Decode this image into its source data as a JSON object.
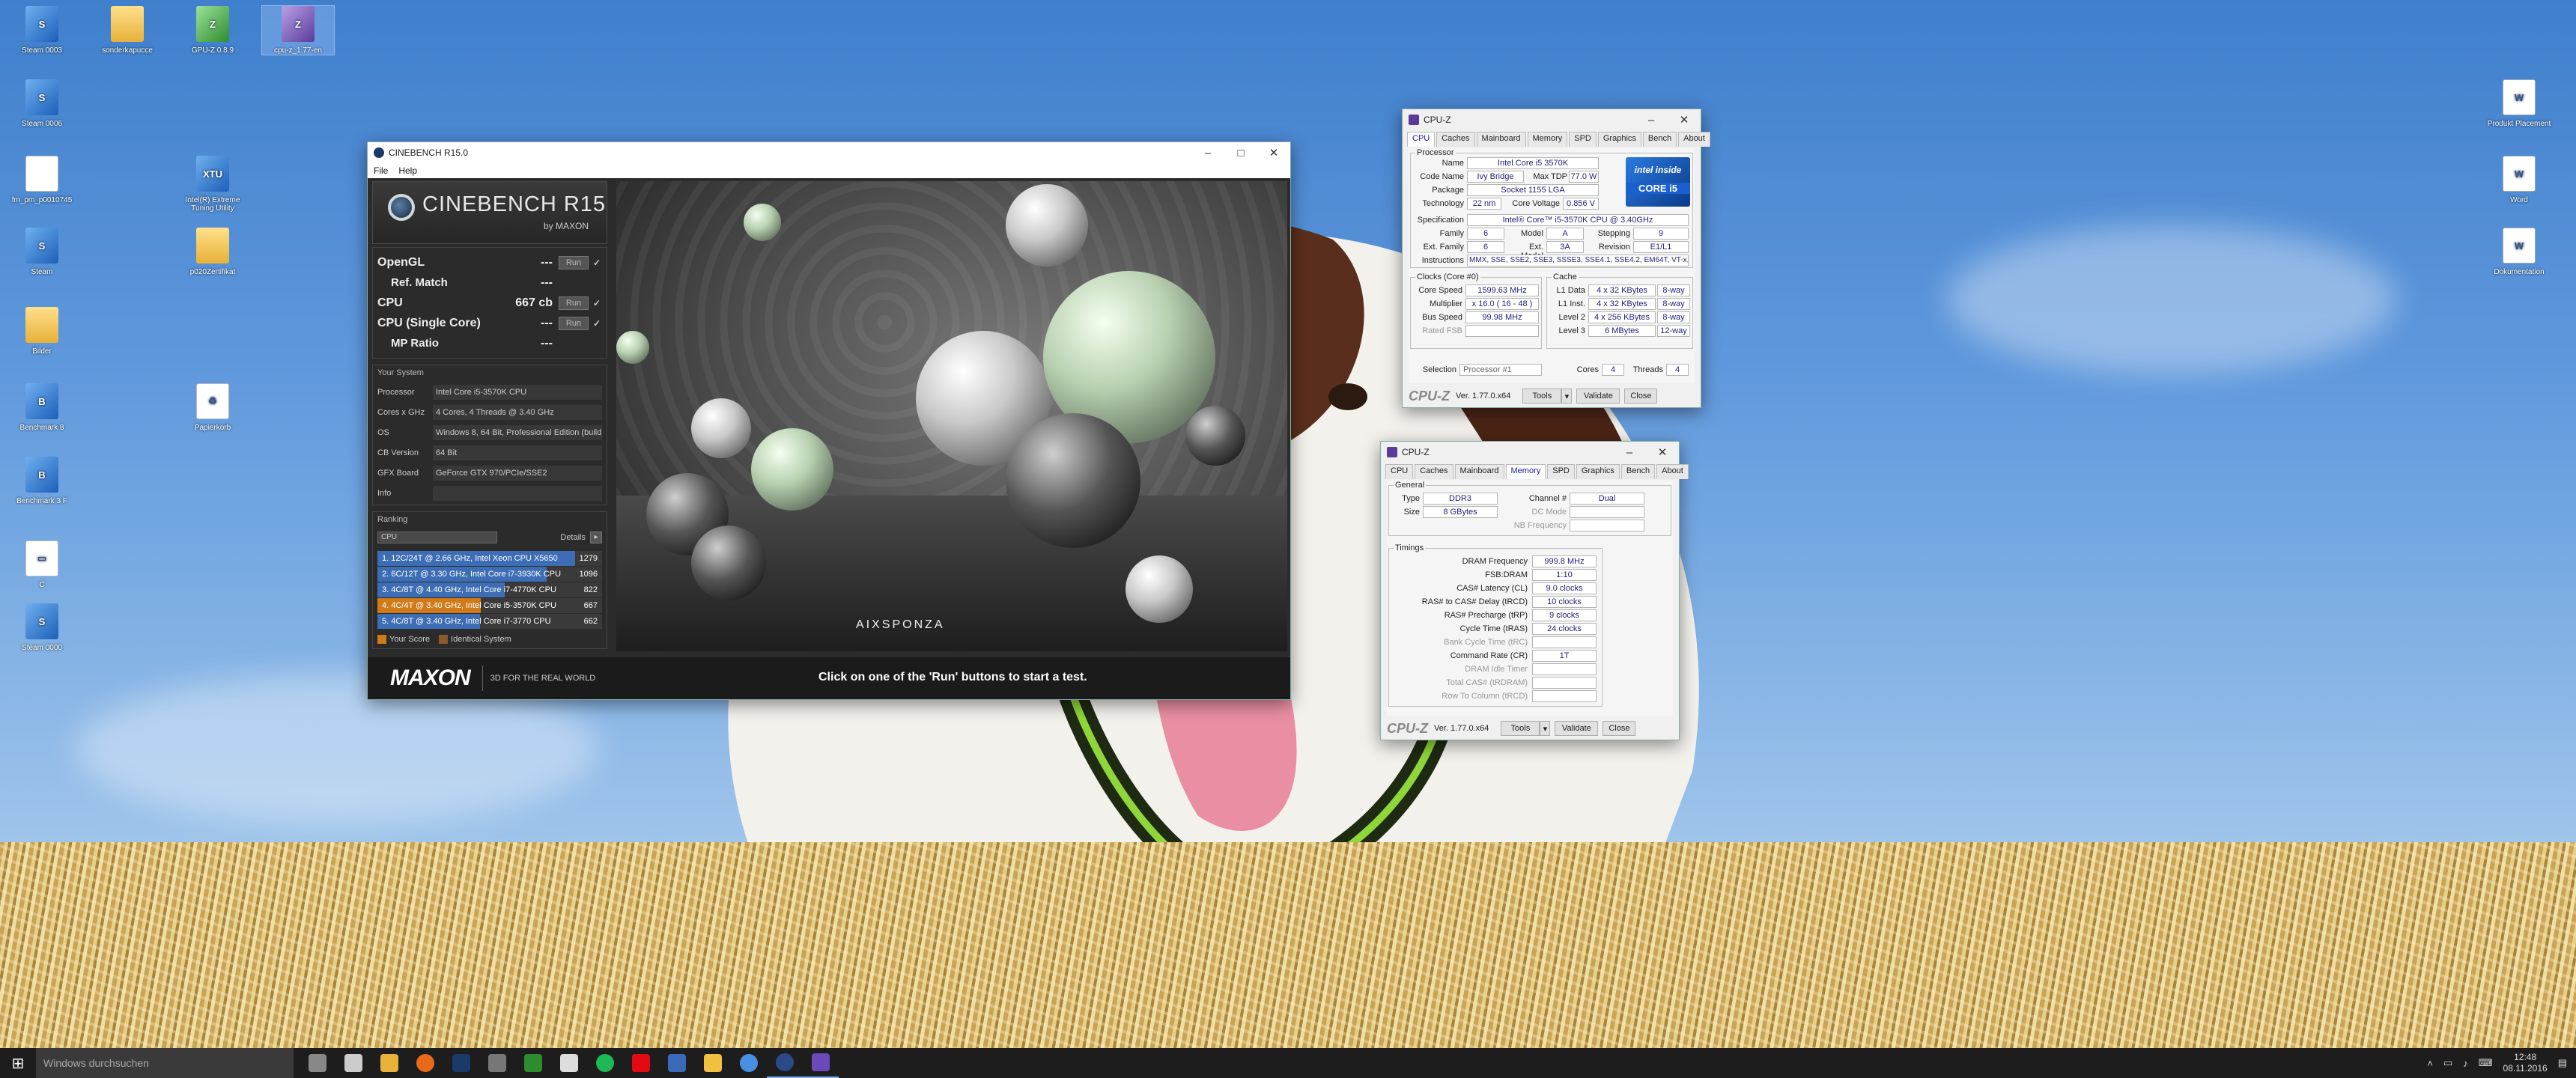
{
  "desktop_icons": [
    {
      "label": "Steam 0003",
      "glyph": "S"
    },
    {
      "label": "sonderkapucce",
      "glyph": ""
    },
    {
      "label": "GPU-Z 0.8.9",
      "glyph": "Z"
    },
    {
      "label": "cpu-z_1.77-en",
      "glyph": "Z"
    },
    {
      "label": "Steam 0006",
      "glyph": "S"
    },
    {
      "label": "fm_pm_p0010745",
      "glyph": ""
    },
    {
      "label": "Intel(R) Extreme Tuning Utility",
      "glyph": "XTU"
    },
    {
      "label": "Steam",
      "glyph": "S"
    },
    {
      "label": "p020Zertifikat",
      "glyph": ""
    },
    {
      "label": "Bilder",
      "glyph": ""
    },
    {
      "label": "Benchmark 8",
      "glyph": "B"
    },
    {
      "label": "Papierkorb",
      "glyph": "♻"
    },
    {
      "label": "Benchmark 3 F",
      "glyph": "B"
    },
    {
      "label": "C",
      "glyph": "▭"
    },
    {
      "label": "Steam 0000",
      "glyph": "S"
    },
    {
      "label": "Produkt Placement",
      "glyph": "W"
    },
    {
      "label": "Word",
      "glyph": "W"
    },
    {
      "label": "Dokumentation",
      "glyph": "W"
    }
  ],
  "cinebench": {
    "title": "CINEBENCH R15.0",
    "menu": [
      "File",
      "Help"
    ],
    "logo_name": "CINEBENCH R15",
    "logo_by": "by MAXON",
    "tests": [
      {
        "label": "OpenGL",
        "value": "---",
        "run": "Run",
        "check": "✓",
        "sub": false
      },
      {
        "label": "Ref. Match",
        "value": "---",
        "run": "",
        "check": "",
        "sub": true
      },
      {
        "label": "CPU",
        "value": "667 cb",
        "run": "Run",
        "check": "✓",
        "sub": false
      },
      {
        "label": "CPU (Single Core)",
        "value": "---",
        "run": "Run",
        "check": "✓",
        "sub": false
      },
      {
        "label": "MP Ratio",
        "value": "---",
        "run": "",
        "check": "",
        "sub": true
      }
    ],
    "system_heading": "Your System",
    "system": [
      {
        "k": "Processor",
        "v": "Intel Core i5-3570K CPU"
      },
      {
        "k": "Cores x GHz",
        "v": "4 Cores, 4 Threads @ 3.40 GHz"
      },
      {
        "k": "OS",
        "v": "Windows 8, 64 Bit, Professional Edition (build 9200)"
      },
      {
        "k": "CB Version",
        "v": "64 Bit"
      },
      {
        "k": "GFX Board",
        "v": "GeForce GTX 970/PCIe/SSE2"
      },
      {
        "k": "Info",
        "v": ""
      }
    ],
    "ranking_heading": "Ranking",
    "ranking_select": "CPU",
    "details_label": "Details",
    "ranking": [
      {
        "t": "1. 12C/24T @ 2.66 GHz, Intel Xeon CPU X5650",
        "s": "1279",
        "frac": 1.0,
        "mine": false
      },
      {
        "t": "2. 6C/12T @ 3.30 GHz, Intel Core i7-3930K CPU",
        "s": "1096",
        "frac": 0.857,
        "mine": false
      },
      {
        "t": "3. 4C/8T @ 4.40 GHz, Intel Core i7-4770K CPU",
        "s": "822",
        "frac": 0.643,
        "mine": false
      },
      {
        "t": "4. 4C/4T @ 3.40 GHz, Intel Core i5-3570K CPU",
        "s": "667",
        "frac": 0.522,
        "mine": true
      },
      {
        "t": "5. 4C/8T @ 3.40 GHz, Intel Core i7-3770 CPU",
        "s": "662",
        "frac": 0.518,
        "mine": false
      }
    ],
    "legend": [
      "Your Score",
      "Identical System"
    ],
    "brand": "MAXON",
    "tagline": "3D FOR THE REAL WORLD",
    "hint": "Click on one of the 'Run' buttons to start a test.",
    "render_credit": "AIXSPONZA",
    "colors": {
      "bar": "#3d6eb5",
      "mine": "#d07a1a",
      "identical": "#8a5a2a"
    }
  },
  "cpuz1": {
    "title": "CPU-Z",
    "tabs": [
      "CPU",
      "Caches",
      "Mainboard",
      "Memory",
      "SPD",
      "Graphics",
      "Bench",
      "About"
    ],
    "active_tab": "CPU",
    "processor_legend": "Processor",
    "name_l": "Name",
    "name": "Intel Core i5 3570K",
    "codename_l": "Code Name",
    "codename": "Ivy Bridge",
    "maxtdp_l": "Max TDP",
    "maxtdp": "77.0 W",
    "package_l": "Package",
    "package": "Socket 1155 LGA",
    "tech_l": "Technology",
    "tech": "22 nm",
    "cvolt_l": "Core Voltage",
    "cvolt": "0.856 V",
    "spec_l": "Specification",
    "spec": "Intel® Core™ i5-3570K CPU @ 3.40GHz",
    "family_l": "Family",
    "family": "6",
    "model_l": "Model",
    "model": "A",
    "stepping_l": "Stepping",
    "stepping": "9",
    "extfam_l": "Ext. Family",
    "extfam": "6",
    "extmodel_l": "Ext. Model",
    "extmodel": "3A",
    "revision_l": "Revision",
    "revision": "E1/L1",
    "instr_l": "Instructions",
    "instr": "MMX, SSE, SSE2, SSE3, SSSE3, SSE4.1, SSE4.2, EM64T, VT-x, AES, AVX",
    "intel_badge": "intel inside",
    "intel_core": "CORE i5",
    "clocks_legend": "Clocks (Core #0)",
    "corespeed_l": "Core Speed",
    "corespeed": "1599.63 MHz",
    "mult_l": "Multiplier",
    "mult": "x 16.0 ( 16 - 48 )",
    "bus_l": "Bus Speed",
    "bus": "99.98 MHz",
    "fsb_l": "Rated FSB",
    "fsb": "",
    "cache_legend": "Cache",
    "l1d_l": "L1 Data",
    "l1d": "4 x 32 KBytes",
    "l1d_w": "8-way",
    "l1i_l": "L1 Inst.",
    "l1i": "4 x 32 KBytes",
    "l1i_w": "8-way",
    "l2_l": "Level 2",
    "l2": "4 x 256 KBytes",
    "l2_w": "8-way",
    "l3_l": "Level 3",
    "l3": "6 MBytes",
    "l3_w": "12-way",
    "selection_l": "Selection",
    "selection": "Processor #1",
    "cores_l": "Cores",
    "cores": "4",
    "threads_l": "Threads",
    "threads": "4",
    "logo": "CPU-Z",
    "version": "Ver. 1.77.0.x64",
    "tools": "Tools",
    "validate": "Validate",
    "close": "Close"
  },
  "cpuz2": {
    "title": "CPU-Z",
    "tabs": [
      "CPU",
      "Caches",
      "Mainboard",
      "Memory",
      "SPD",
      "Graphics",
      "Bench",
      "About"
    ],
    "active_tab": "Memory",
    "general_legend": "General",
    "type_l": "Type",
    "type": "DDR3",
    "size_l": "Size",
    "size": "8 GBytes",
    "channel_l": "Channel #",
    "channel": "Dual",
    "dcmode_l": "DC Mode",
    "dcmode": "",
    "nbfreq_l": "NB Frequency",
    "nbfreq": "",
    "timings_legend": "Timings",
    "timings": [
      {
        "l": "DRAM Frequency",
        "v": "999.8 MHz",
        "dim": false
      },
      {
        "l": "FSB:DRAM",
        "v": "1:10",
        "dim": false
      },
      {
        "l": "CAS# Latency (CL)",
        "v": "9.0 clocks",
        "dim": false
      },
      {
        "l": "RAS# to CAS# Delay (tRCD)",
        "v": "10 clocks",
        "dim": false
      },
      {
        "l": "RAS# Precharge (tRP)",
        "v": "9 clocks",
        "dim": false
      },
      {
        "l": "Cycle Time (tRAS)",
        "v": "24 clocks",
        "dim": false
      },
      {
        "l": "Bank Cycle Time (tRC)",
        "v": "",
        "dim": true
      },
      {
        "l": "Command Rate (CR)",
        "v": "1T",
        "dim": false
      },
      {
        "l": "DRAM Idle Timer",
        "v": "",
        "dim": true
      },
      {
        "l": "Total CAS# (tRDRAM)",
        "v": "",
        "dim": true
      },
      {
        "l": "Row To Column (tRCD)",
        "v": "",
        "dim": true
      }
    ],
    "logo": "CPU-Z",
    "version": "Ver. 1.77.0.x64",
    "tools": "Tools",
    "validate": "Validate",
    "close": "Close"
  },
  "taskbar": {
    "search_placeholder": "Windows durchsuchen",
    "apps": [
      "task-view",
      "mail",
      "explorer",
      "firefox",
      "steam",
      "dragon",
      "gpu-z",
      "chat",
      "spotify",
      "netflix",
      "libreoffice",
      "files",
      "chrome",
      "cinebench",
      "cpu-z"
    ],
    "time": "12:48",
    "date": "08.11.2016"
  }
}
